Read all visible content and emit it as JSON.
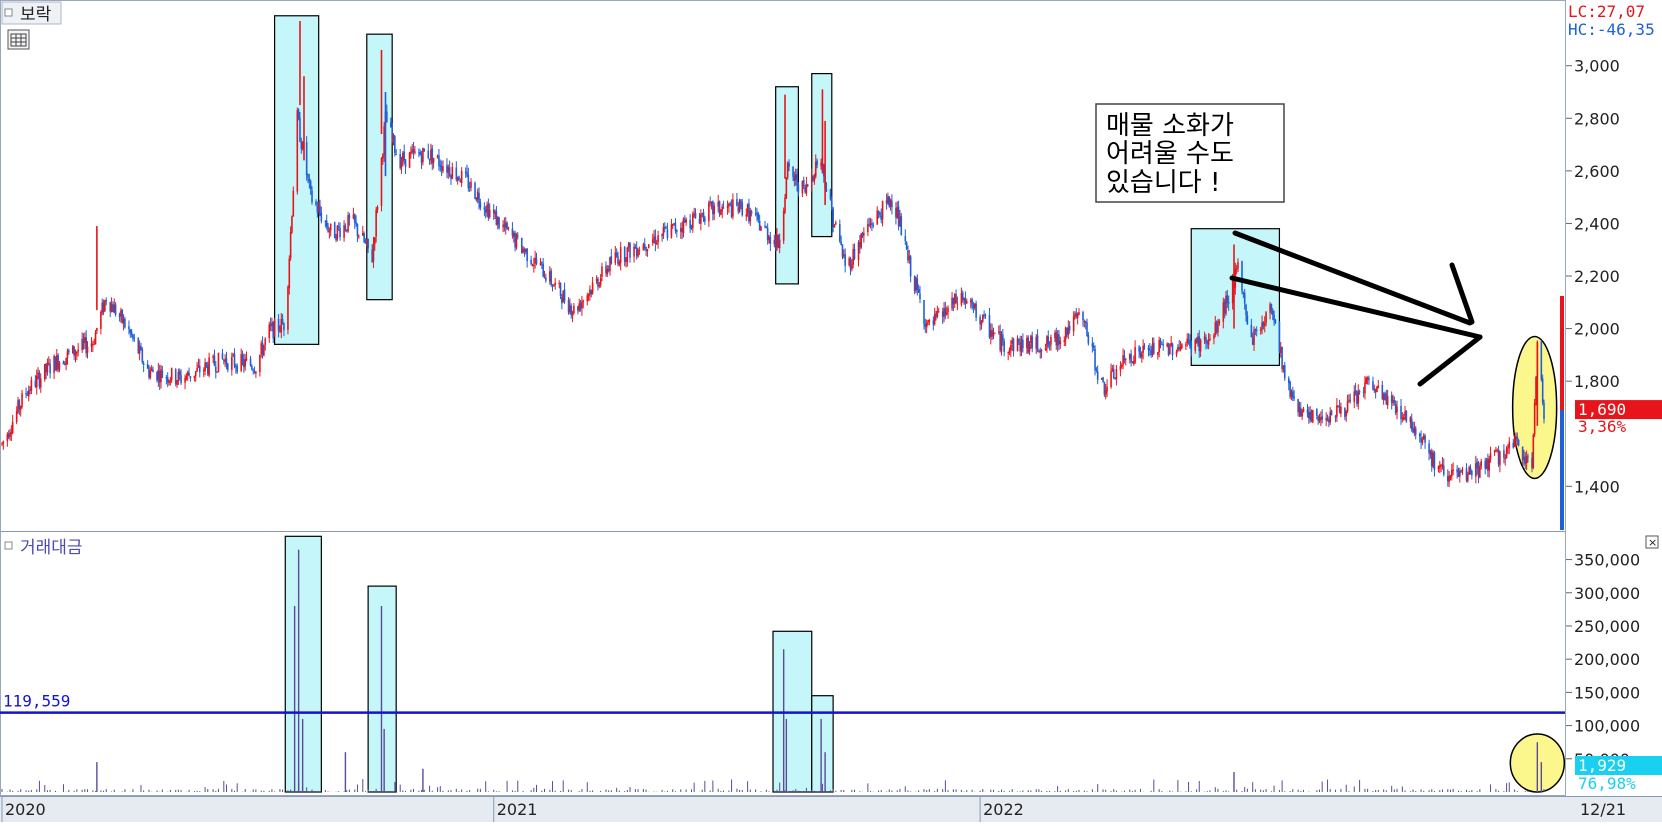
{
  "stock_label": "보락",
  "volume_label": "거래대금",
  "lc_text": "LC:27,07",
  "hc_text": "HC:-46,35",
  "last_price_text": "1,690",
  "last_change_text": "3,36%",
  "last_vol_text": "1,929",
  "last_vol_pct_text": "76,98%",
  "avg_vol_text": "119,559",
  "callout_lines": [
    "매물  소화가",
    "어려울  수도",
    "있습니다  !"
  ],
  "date_right": "12/21",
  "colors": {
    "up": "#e8141b",
    "down": "#1f5fd8",
    "highlight_fill": "#c5f6f9",
    "ellipse_fill": "#fbf78c",
    "avg_line": "#1313d0",
    "price_tag": "#e8141b",
    "vol_tag": "#1ad0f0",
    "volume_bar": "#5a4a9a"
  },
  "icons": {
    "collapse": "square-bullet-icon",
    "table": "table-icon",
    "close": "close-icon"
  },
  "chart_data": [
    {
      "type": "candlestick",
      "price_axis_ticks": [
        "3,000",
        "2,800",
        "2,600",
        "2,400",
        "2,200",
        "2,000",
        "1,800",
        "1,400"
      ],
      "ylim": [
        1230,
        3250
      ],
      "x_ticks": [
        "2020",
        "2021",
        "2022"
      ],
      "last_price": 1690,
      "trend_points": [
        [
          "2020-01-02",
          1560
        ],
        [
          "2020-01-20",
          1760
        ],
        [
          "2020-02-10",
          1870
        ],
        [
          "2020-03-10",
          1950
        ],
        [
          "2020-03-20",
          2120
        ],
        [
          "2020-04-05",
          2000
        ],
        [
          "2020-04-20",
          1840
        ],
        [
          "2020-05-15",
          1810
        ],
        [
          "2020-06-15",
          1880
        ],
        [
          "2020-07-10",
          1860
        ],
        [
          "2020-07-20",
          1990
        ],
        [
          "2020-08-01",
          2020
        ],
        [
          "2020-08-10",
          2800
        ],
        [
          "2020-08-20",
          2500
        ],
        [
          "2020-09-05",
          2360
        ],
        [
          "2020-09-20",
          2410
        ],
        [
          "2020-10-05",
          2270
        ],
        [
          "2020-10-15",
          2800
        ],
        [
          "2020-10-25",
          2640
        ],
        [
          "2020-11-15",
          2670
        ],
        [
          "2020-12-15",
          2560
        ],
        [
          "2021-01-10",
          2390
        ],
        [
          "2021-02-10",
          2220
        ],
        [
          "2021-03-05",
          2070
        ],
        [
          "2021-04-05",
          2270
        ],
        [
          "2021-05-15",
          2370
        ],
        [
          "2021-06-15",
          2450
        ],
        [
          "2021-07-10",
          2460
        ],
        [
          "2021-08-05",
          2320
        ],
        [
          "2021-08-12",
          2600
        ],
        [
          "2021-08-25",
          2520
        ],
        [
          "2021-09-05",
          2660
        ],
        [
          "2021-09-15",
          2420
        ],
        [
          "2021-09-25",
          2230
        ],
        [
          "2021-10-10",
          2380
        ],
        [
          "2021-10-30",
          2500
        ],
        [
          "2021-11-10",
          2260
        ],
        [
          "2021-11-25",
          2000
        ],
        [
          "2021-12-20",
          2120
        ],
        [
          "2022-01-20",
          1940
        ],
        [
          "2022-02-25",
          1940
        ],
        [
          "2022-03-20",
          2050
        ],
        [
          "2022-04-05",
          1770
        ],
        [
          "2022-04-25",
          1900
        ],
        [
          "2022-05-25",
          1930
        ],
        [
          "2022-06-25",
          1950
        ],
        [
          "2022-07-15",
          2220
        ],
        [
          "2022-07-25",
          1960
        ],
        [
          "2022-08-10",
          2080
        ],
        [
          "2022-08-20",
          1790
        ],
        [
          "2022-09-05",
          1650
        ],
        [
          "2022-10-05",
          1700
        ],
        [
          "2022-10-20",
          1790
        ],
        [
          "2022-11-15",
          1680
        ],
        [
          "2022-12-01",
          1580
        ],
        [
          "2022-12-10",
          1470
        ],
        [
          "2022-12-30",
          1430
        ],
        [
          "2023-01-25",
          1510
        ],
        [
          "2023-02-10",
          1560
        ],
        [
          "2023-02-20",
          1470
        ],
        [
          "2023-02-24",
          1950
        ],
        [
          "2023-03-01",
          1690
        ]
      ],
      "highlight_boxes": [
        {
          "start": "2020-07-24",
          "end": "2020-08-26",
          "low": 1940,
          "high": 3190
        },
        {
          "start": "2020-10-01",
          "end": "2020-10-20",
          "low": 2110,
          "high": 3120
        },
        {
          "start": "2021-08-03",
          "end": "2021-08-20",
          "low": 2170,
          "high": 2920
        },
        {
          "start": "2021-08-30",
          "end": "2021-09-14",
          "low": 2350,
          "high": 2970
        },
        {
          "start": "2022-06-10",
          "end": "2022-08-15",
          "low": 1860,
          "high": 2380
        }
      ],
      "highlight_ellipse": {
        "center": "2023-02-22",
        "value": 1700
      }
    },
    {
      "type": "bar",
      "series_label": "거래대금",
      "y_axis_ticks": [
        "350,000",
        "300,000",
        "250,000",
        "200,000",
        "150,000",
        "100,000",
        "50,000"
      ],
      "ylim": [
        0,
        390000
      ],
      "avg_value": 119559,
      "spikes": [
        [
          "2020-03-13",
          45000
        ],
        [
          "2020-08-11",
          365000
        ],
        [
          "2020-08-08",
          280000
        ],
        [
          "2020-08-14",
          110000
        ],
        [
          "2020-09-15",
          60000
        ],
        [
          "2020-10-12",
          280000
        ],
        [
          "2020-10-14",
          95000
        ],
        [
          "2020-11-12",
          35000
        ],
        [
          "2021-08-09",
          215000
        ],
        [
          "2021-08-11",
          110000
        ],
        [
          "2021-09-06",
          110000
        ],
        [
          "2021-09-09",
          60000
        ],
        [
          "2022-07-12",
          30000
        ],
        [
          "2023-02-24",
          75000
        ],
        [
          "2023-02-27",
          45000
        ]
      ],
      "highlight_boxes": [
        {
          "start": "2020-08-01",
          "end": "2020-08-28",
          "high": 385000
        },
        {
          "start": "2020-10-02",
          "end": "2020-10-23",
          "high": 310000
        },
        {
          "start": "2021-08-01",
          "end": "2021-08-30",
          "high": 242000
        },
        {
          "start": "2021-08-30",
          "end": "2021-09-15",
          "high": 145000
        }
      ]
    }
  ]
}
